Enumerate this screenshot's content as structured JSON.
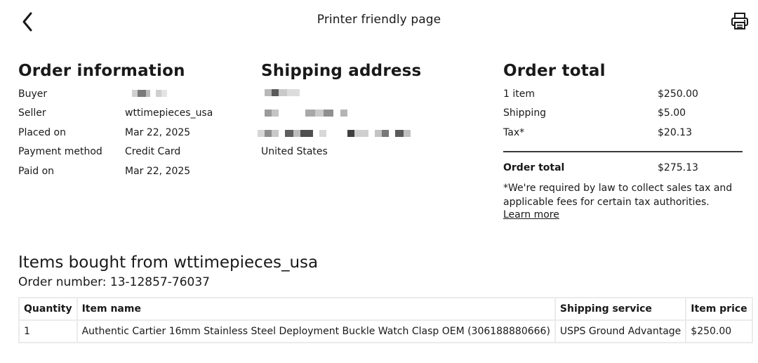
{
  "header": {
    "title": "Printer friendly page",
    "back_icon": "chevron-left-icon",
    "print_icon": "printer-icon"
  },
  "order_information": {
    "heading": "Order information",
    "rows": [
      {
        "label": "Buyer",
        "value": ""
      },
      {
        "label": "Seller",
        "value": "wttimepieces_usa"
      },
      {
        "label": "Placed on",
        "value": "Mar 22, 2025"
      },
      {
        "label": "Payment method",
        "value": "Credit Card"
      },
      {
        "label": "Paid on",
        "value": "Mar 22, 2025"
      }
    ]
  },
  "shipping_address": {
    "heading": "Shipping address",
    "country": "United States"
  },
  "order_total": {
    "heading": "Order total",
    "rows": [
      {
        "label": "1 item",
        "value": "$250.00"
      },
      {
        "label": "Shipping",
        "value": "$5.00"
      },
      {
        "label": "Tax*",
        "value": "$20.13"
      }
    ],
    "total_label": "Order total",
    "total_value": "$275.13",
    "note": "*We're required by law to collect sales tax and applicable fees for certain tax authorities.",
    "learn_more": "Learn more"
  },
  "items": {
    "heading": "Items bought from wttimepieces_usa",
    "order_number": "Order number: 13-12857-76037",
    "columns": [
      "Quantity",
      "Item name",
      "Shipping service",
      "Item price"
    ],
    "rows": [
      {
        "quantity": "1",
        "name": "Authentic Cartier 16mm Stainless Steel Deployment Buckle Watch Clasp OEM (306188880666)",
        "shipping": "USPS Ground Advantage",
        "price": "$250.00"
      }
    ]
  }
}
